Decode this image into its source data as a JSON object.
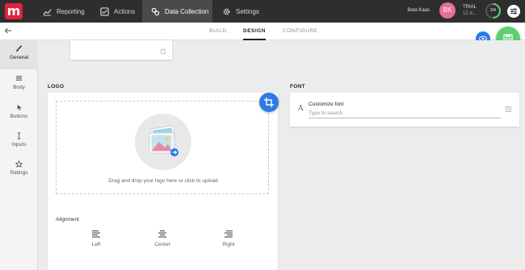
{
  "app": {
    "logo_letter": "m"
  },
  "nav": {
    "reporting": "Reporting",
    "actions": "Actions",
    "data_collection": "Data Collection",
    "settings": "Settings"
  },
  "user": {
    "name": "Beta Kaas",
    "initials": "BK",
    "trial_label": "TRIAL",
    "trial_sub": "12 d...",
    "progress_text": "2/4",
    "progress_fraction": 0.5
  },
  "tabs": {
    "build": "BUILD",
    "design": "DESIGN",
    "configure": "CONFIGURE"
  },
  "sidebar": {
    "items": [
      {
        "label": "General",
        "icon": "brush-icon"
      },
      {
        "label": "Body",
        "icon": "align-icon"
      },
      {
        "label": "Buttons",
        "icon": "cursor-icon"
      },
      {
        "label": "Inputs",
        "icon": "text-cursor-icon"
      },
      {
        "label": "Ratings",
        "icon": "star-icon"
      }
    ]
  },
  "logo_section": {
    "title": "LOGO",
    "upload_text": "Drag and drop your logo here or click to upload",
    "alignment_label": "Alignment",
    "alignments": [
      "Left",
      "Center",
      "Right"
    ]
  },
  "font_section": {
    "title": "FONT",
    "customize_label": "Customize font",
    "search_placeholder": "Type to search"
  },
  "colors": {
    "brand": "#e0223a",
    "accent_blue": "#2c7be5",
    "save_green": "#5cd06e",
    "avatar_pink": "#e66e9a"
  }
}
